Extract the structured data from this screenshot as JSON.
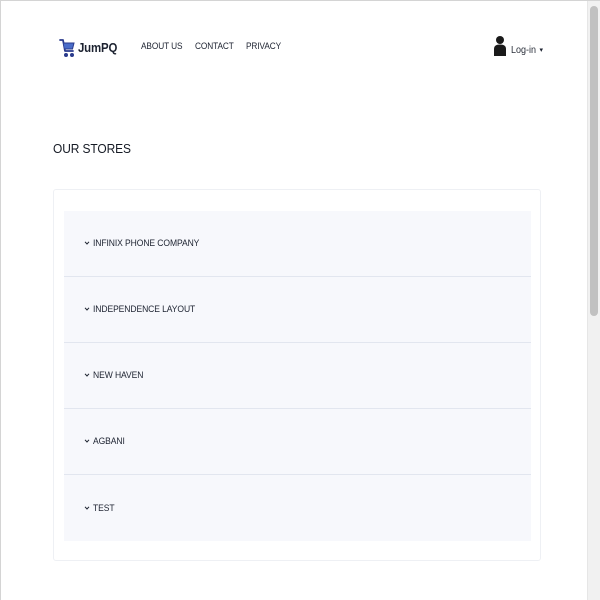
{
  "header": {
    "brand": "JumPQ",
    "nav": [
      {
        "label": "ABOUT US"
      },
      {
        "label": "CONTACT"
      },
      {
        "label": "PRIVACY"
      }
    ],
    "login_label": "Log-in",
    "caret": "▾"
  },
  "main": {
    "title": "OUR STORES",
    "stores": [
      {
        "name": "INFINIX PHONE COMPANY"
      },
      {
        "name": "INDEPENDENCE LAYOUT"
      },
      {
        "name": "NEW HAVEN"
      },
      {
        "name": "AGBANI"
      },
      {
        "name": "TEST"
      }
    ]
  },
  "icons": {
    "brand": "shopping-cart-icon",
    "login": "user-icon",
    "expand": "chevron-down-icon"
  },
  "colors": {
    "brand_icon": "#2a3a8c",
    "text": "#1c2230",
    "store_row_bg": "#f7f8fc",
    "row_divider": "#e2e6ef"
  }
}
